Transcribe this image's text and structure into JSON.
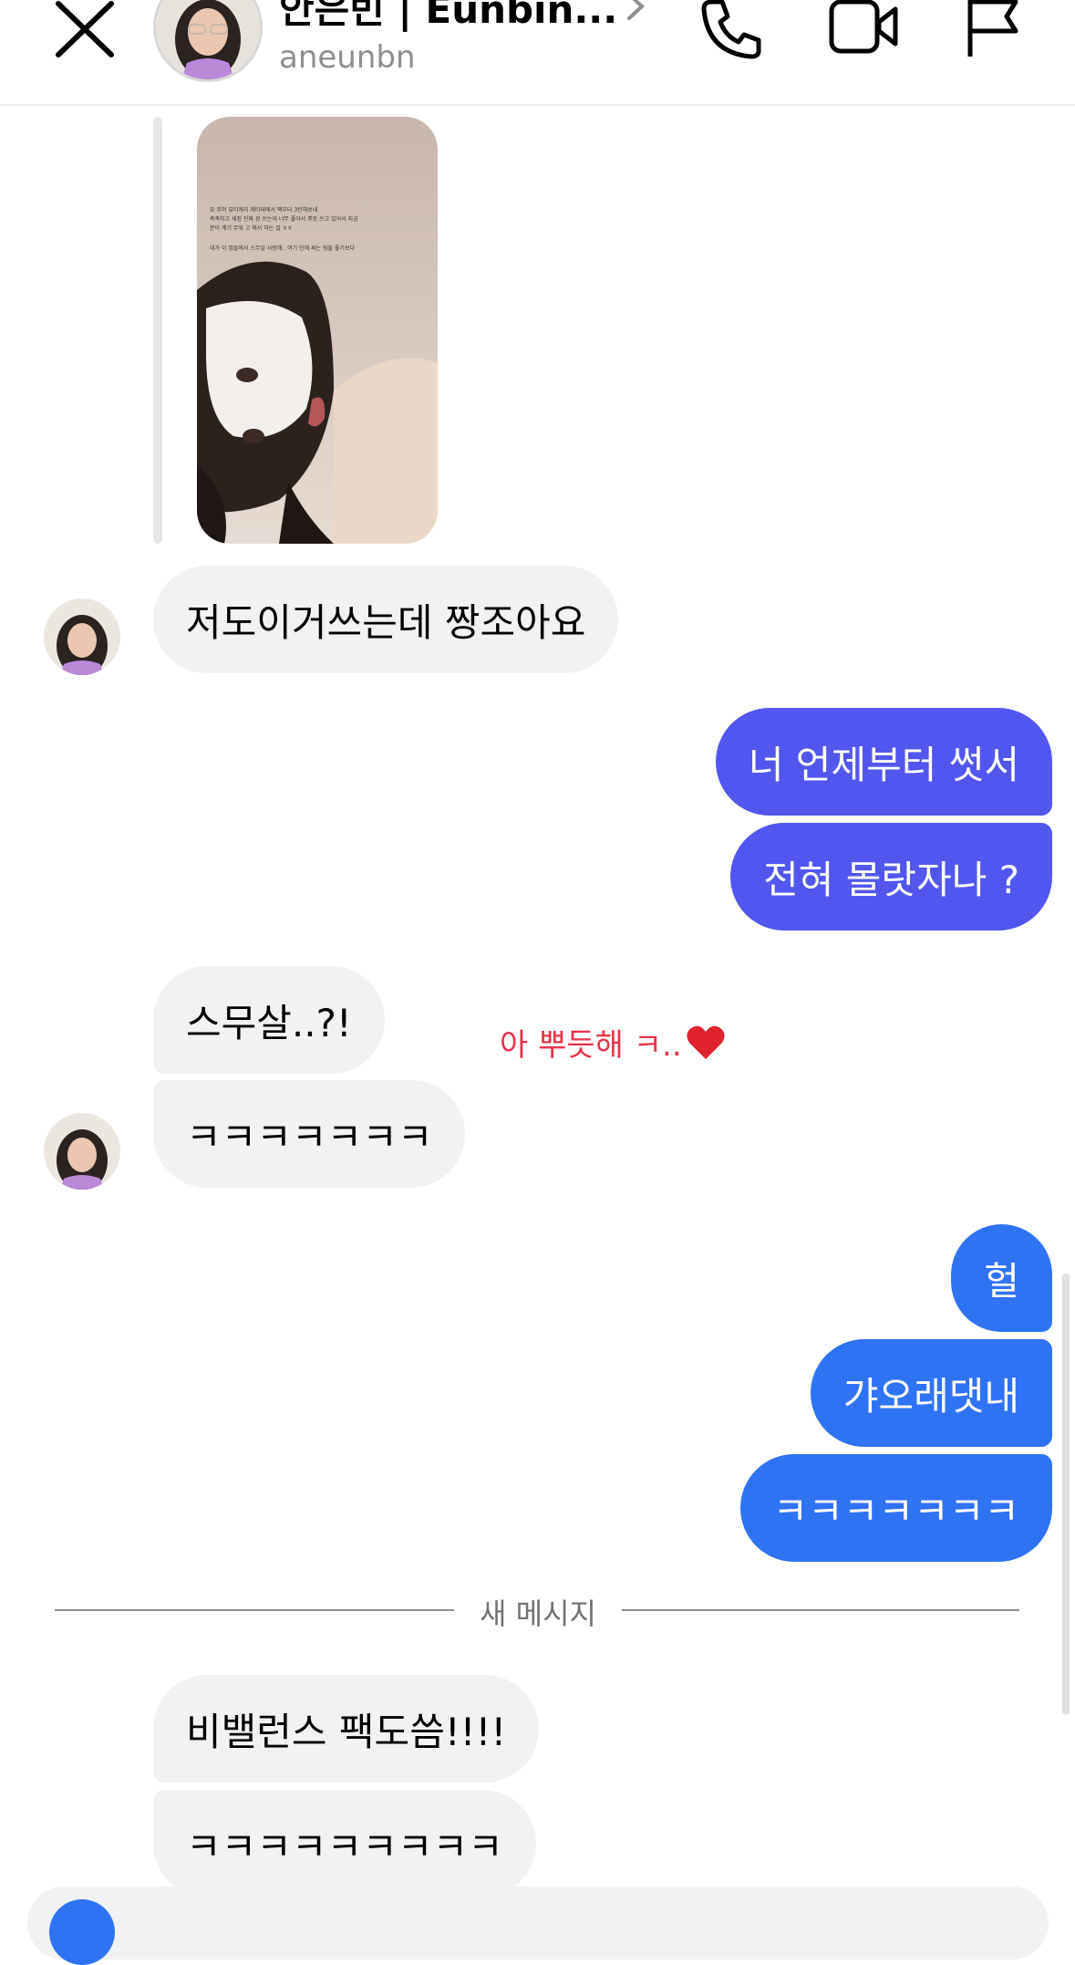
{
  "header": {
    "name": "안은빈 | Eunbin...",
    "handle": "aneunbn"
  },
  "story_image": {
    "caption_lines": [
      "요 주머 뷰티캐리 레티테에서 팩부터 3탄해보네",
      "촉촉하고 세정 진짜 굉 쓰는데 너무 좋아서 뿌듯 쓰고 있어서 지금",
      "분이 계기 무워 고 해서 하는 걸 ㅎㅎ",
      "",
      "데가 이 앱들에서 스무살 사랑해.. 여기 안에 써는 팀들 좋기보다"
    ]
  },
  "messages": [
    {
      "side": "in",
      "text": "저도이거쓰는데 짱조아요"
    },
    {
      "side": "out",
      "color": "purple",
      "text": "너 언제부터 썻서"
    },
    {
      "side": "out",
      "color": "purple",
      "text": "전혀 몰랏자나 ?"
    },
    {
      "side": "in",
      "text": "스무살..?!"
    },
    {
      "side": "in",
      "text": "ㅋㅋㅋㅋㅋㅋㅋ"
    },
    {
      "side": "out",
      "color": "blue",
      "text": "헐"
    },
    {
      "side": "out",
      "color": "blue",
      "text": "갸오래댓내"
    },
    {
      "side": "out",
      "color": "blue",
      "text": "ㅋㅋㅋㅋㅋㅋㅋ"
    },
    {
      "side": "in",
      "text": "비밸런스 팩도씀!!!!"
    },
    {
      "side": "in",
      "text": "ㅋㅋㅋㅋㅋㅋㅋㅋㅋ"
    }
  ],
  "annotation": {
    "text": "아 뿌듯해 ㅋ.."
  },
  "divider": {
    "label": "새 메시지"
  },
  "colors": {
    "purple": "#5356ee",
    "blue": "#2f73f5",
    "incoming": "#f1f2f4",
    "annotation": "#e8334a"
  }
}
